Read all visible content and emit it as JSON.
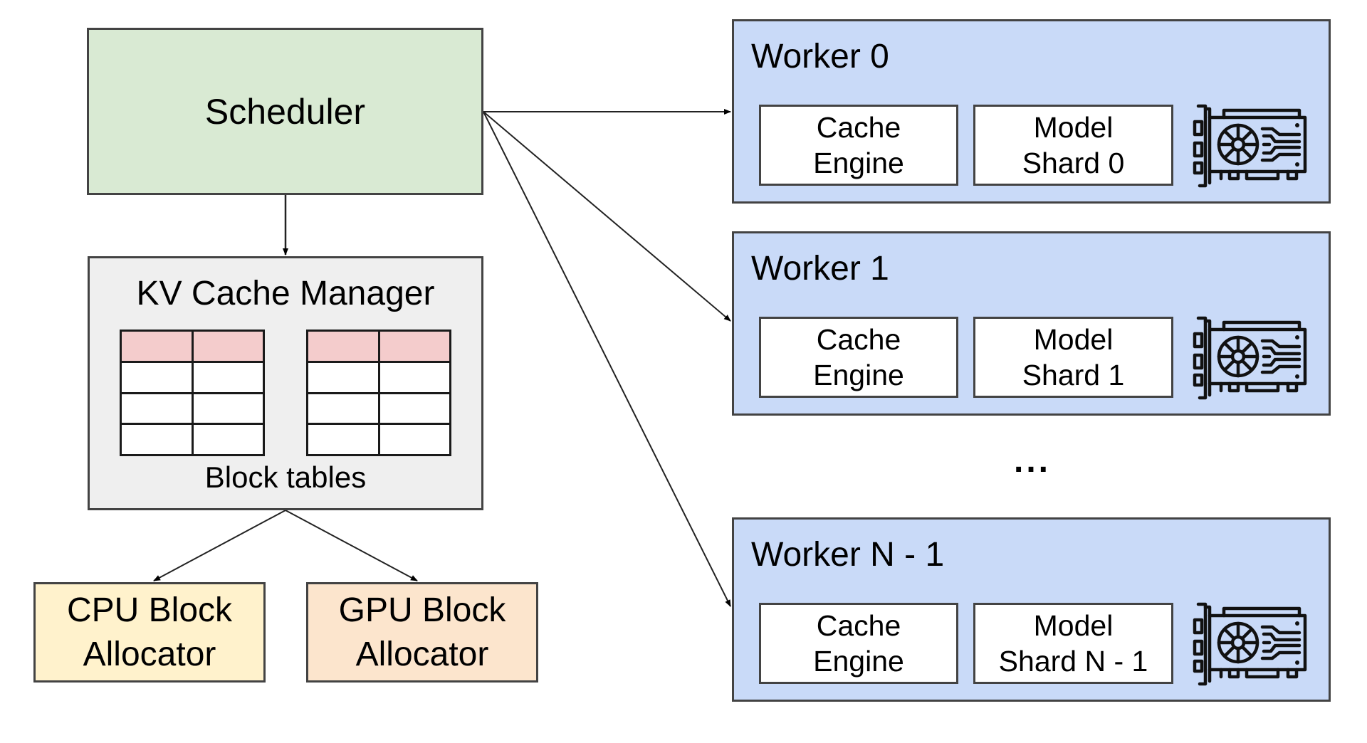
{
  "diagram": {
    "scheduler": {
      "label": "Scheduler"
    },
    "kv_cache_manager": {
      "title": "KV Cache Manager",
      "caption": "Block tables",
      "tables": [
        {
          "columns": 2,
          "rows": 4,
          "header_row_color": "#f4cccc"
        },
        {
          "columns": 2,
          "rows": 4,
          "header_row_color": "#f4cccc"
        }
      ]
    },
    "allocators": [
      {
        "line1": "CPU Block",
        "line2": "Allocator",
        "color": "#fff2cc"
      },
      {
        "line1": "GPU Block",
        "line2": "Allocator",
        "color": "#fce5cd"
      }
    ],
    "workers": [
      {
        "title": "Worker 0",
        "cache_line1": "Cache",
        "cache_line2": "Engine",
        "model_line1": "Model",
        "model_line2": "Shard 0",
        "icon": "gpu-card-icon"
      },
      {
        "title": "Worker 1",
        "cache_line1": "Cache",
        "cache_line2": "Engine",
        "model_line1": "Model",
        "model_line2": "Shard 1",
        "icon": "gpu-card-icon"
      },
      {
        "title": "Worker N - 1",
        "cache_line1": "Cache",
        "cache_line2": "Engine",
        "model_line1": "Model",
        "model_line2": "Shard N - 1",
        "icon": "gpu-card-icon"
      }
    ],
    "ellipsis": "...",
    "edges": [
      {
        "from": "Scheduler",
        "to": "KV Cache Manager"
      },
      {
        "from": "Scheduler",
        "to": "Worker 0"
      },
      {
        "from": "Scheduler",
        "to": "Worker 1"
      },
      {
        "from": "Scheduler",
        "to": "Worker N - 1"
      },
      {
        "from": "KV Cache Manager",
        "to": "CPU Block Allocator"
      },
      {
        "from": "KV Cache Manager",
        "to": "GPU Block Allocator"
      }
    ],
    "colors": {
      "scheduler": "#d9ead3",
      "kv_cache_manager": "#efefef",
      "worker": "#c9daf8",
      "border": "#434343"
    }
  }
}
